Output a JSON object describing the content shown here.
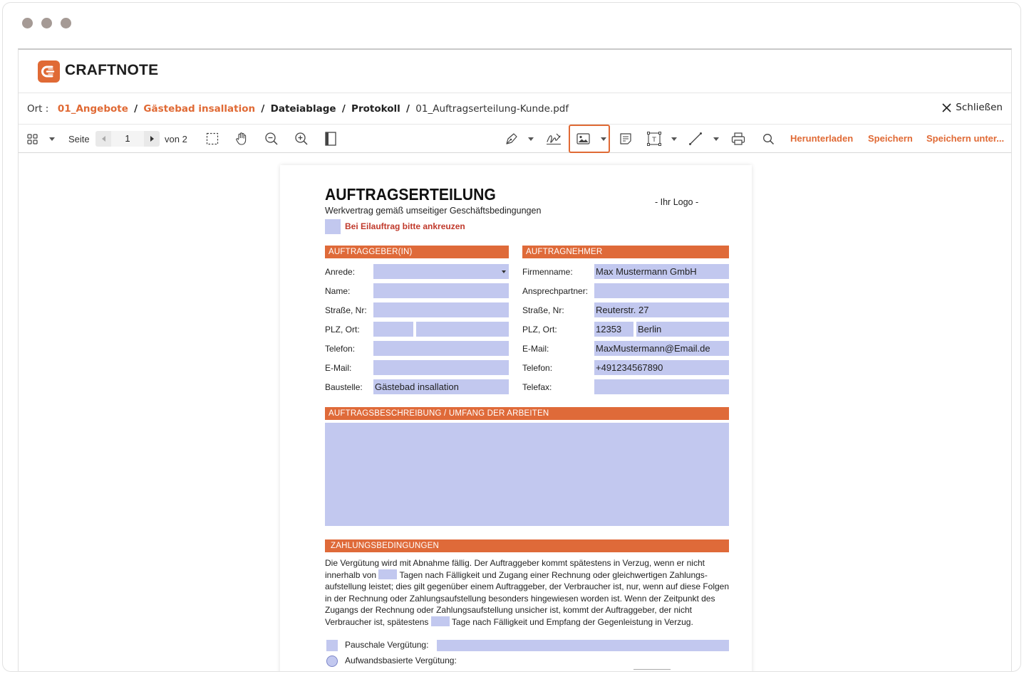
{
  "app": {
    "logo_text": "CRAFTNOTE"
  },
  "breadcrumb": {
    "label": "Ort :",
    "items": [
      "01_Angebote",
      "Gästebad insallation",
      "Dateiablage",
      "Protokoll",
      "01_Auftragserteilung-Kunde.pdf"
    ],
    "separator": "/"
  },
  "close": {
    "label": "Schließen"
  },
  "toolbar": {
    "page_label": "Seite",
    "page_value": "1",
    "page_total": "von 2",
    "download_label": "Herunterladen",
    "save_label": "Speichern",
    "save_as_label": "Speichern unter...",
    "icons": [
      "thumbnails-icon",
      "select-area-icon",
      "pan-hand-icon",
      "zoom-out-icon",
      "zoom-in-icon",
      "fit-page-icon",
      "pen-icon",
      "signature-icon",
      "image-icon",
      "note-icon",
      "text-box-icon",
      "line-icon",
      "print-icon",
      "search-icon"
    ]
  },
  "document": {
    "title": "AUFTRAGSERTEILUNG",
    "subtitle": "Werkvertrag gemäß umseitiger Geschäftsbedingungen",
    "logo_placeholder": "- Ihr Logo -",
    "rush_label": "Bei Eilauftrag bitte ankreuzen",
    "client": {
      "heading": "AUFTRAGGEBER(IN)",
      "labels": [
        "Anrede:",
        "Name:",
        "Straße, Nr:",
        "PLZ, Ort:",
        "Telefon:",
        "E-Mail:",
        "Baustelle:"
      ],
      "values": {
        "anrede": "",
        "name": "",
        "strasse": "",
        "plz": "",
        "ort": "",
        "telefon": "",
        "email": "",
        "baustelle": "Gästebad insallation"
      }
    },
    "contractor": {
      "heading": "AUFTRAGNEHMER",
      "labels": [
        "Firmenname:",
        "Ansprechpartner:",
        "Straße, Nr:",
        "PLZ, Ort:",
        "E-Mail:",
        "Telefon:",
        "Telefax:"
      ],
      "values": {
        "firma": "Max Mustermann GmbH",
        "ansprechpartner": "",
        "strasse": "Reuterstr. 27",
        "plz": "12353",
        "ort": "Berlin",
        "email": "MaxMustermann@Email.de",
        "telefon": "+491234567890",
        "telefax": ""
      }
    },
    "description": {
      "heading": "AUFTRAGSBESCHREIBUNG / UMFANG DER ARBEITEN"
    },
    "payment": {
      "heading": "ZAHLUNGSBEDINGUNGEN",
      "text_1": "Die Vergütung wird mit Abnahme fällig. Der Auftraggeber kommt spätestens in Verzug, wenn er nicht innerhalb von",
      "text_2": "Tagen nach Fälligkeit und Zugang einer Rechnung oder gleichwertigen Zahlungs­aufstellung leistet; dies gilt gegenüber einem Auftraggeber, der Verbraucher ist, nur, wenn auf diese Fol­gen in der Rechnung oder Zahlungsaufstellung besonders hingewiesen worden ist. Wenn der Zeitpunkt des Zugangs der Rechnung oder Zahlungsaufstellung unsicher ist, kommt der Auftraggeber, der nicht Verbraucher ist, spätestens",
      "text_3": "Tage nach Fälligkeit und Empfang der Gegenleistung in Verzug.",
      "option_flat": "Pauschale Vergütung:",
      "option_effort": "Aufwandsbasierte Vergütung:"
    }
  },
  "colors": {
    "accent": "#e06a35",
    "section": "#df6a39",
    "field": "#c2c8ef",
    "rush": "#c0392b"
  }
}
